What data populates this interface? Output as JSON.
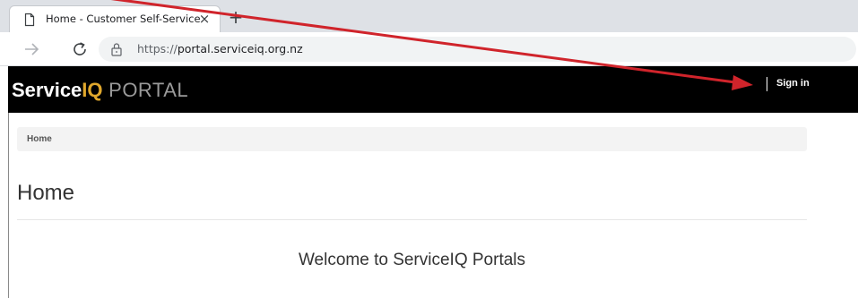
{
  "browser": {
    "tab": {
      "title": "Home - Customer Self-Service",
      "close_glyph": "×",
      "icon": "page-icon"
    },
    "new_tab_glyph": "+",
    "address": {
      "scheme": "https://",
      "host": "portal.serviceiq.org.nz"
    }
  },
  "header": {
    "brand": {
      "part1": "Service",
      "part2": "IQ",
      "part3": " PORTAL"
    },
    "sign_in_label": "Sign in"
  },
  "breadcrumb": {
    "home": "Home"
  },
  "main": {
    "title": "Home",
    "welcome": "Welcome to ServiceIQ Portals"
  },
  "colors": {
    "header_bg": "#000000",
    "brand_accent": "#e0a72c",
    "annotation_arrow": "#d0242b"
  }
}
